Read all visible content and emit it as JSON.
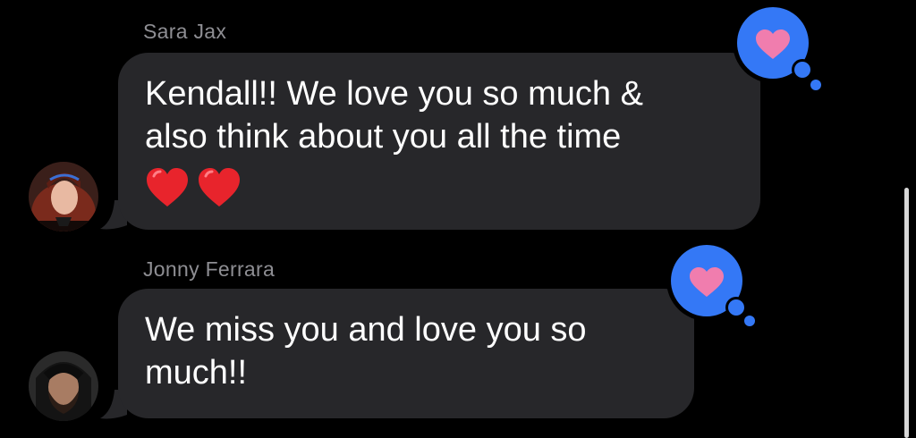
{
  "messages": [
    {
      "sender": "Sara Jax",
      "text": "Kendall!! We love you so much &\nalso think about you all the time",
      "emoji": [
        "red-heart",
        "red-heart"
      ],
      "reaction": "heart"
    },
    {
      "sender": "Jonny Ferrara",
      "text": "We miss you and love you so\nmuch!!",
      "emoji": [],
      "reaction": "heart"
    }
  ],
  "colors": {
    "background": "#000000",
    "bubble": "#27272a",
    "sender_name": "#8e8e93",
    "tapback_bubble": "#3478f6",
    "tapback_heart": "#f07dae",
    "emoji_heart": "#e8242c"
  }
}
